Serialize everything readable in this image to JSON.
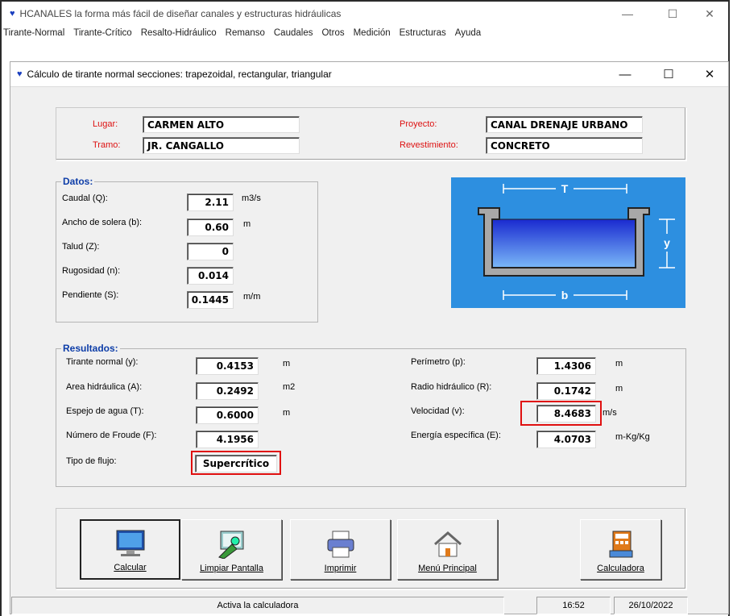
{
  "main_window": {
    "title": "HCANALES la forma más fácil de diseñar canales y estructuras hidráulicas",
    "controls": [
      "—",
      "☐",
      "✕"
    ]
  },
  "menu": [
    "Tirante-Normal",
    "Tirante-Crítico",
    "Resalto-Hidráulico",
    "Remanso",
    "Caudales",
    "Otros",
    "Medición",
    "Estructuras",
    "Ayuda"
  ],
  "child_window": {
    "title": "Cálculo de tirante normal secciones: trapezoidal, rectangular, triangular",
    "controls": [
      "—",
      "☐",
      "✕"
    ]
  },
  "header": {
    "lugar_label": "Lugar:",
    "lugar_value": "CARMEN ALTO",
    "tramo_label": "Tramo:",
    "tramo_value": "JR. CANGALLO",
    "proyecto_label": "Proyecto:",
    "proyecto_value": "CANAL DRENAJE URBANO",
    "revestimiento_label": "Revestimiento:",
    "revestimiento_value": "CONCRETO"
  },
  "datos": {
    "title": "Datos:",
    "rows": [
      {
        "label": "Caudal (Q):",
        "value": "2.11",
        "unit": "m3/s"
      },
      {
        "label": "Ancho de solera (b):",
        "value": "0.60",
        "unit": "m"
      },
      {
        "label": "Talud (Z):",
        "value": "0",
        "unit": ""
      },
      {
        "label": "Rugosidad (n):",
        "value": "0.014",
        "unit": ""
      },
      {
        "label": "Pendiente (S):",
        "value": "0.1445",
        "unit": "m/m"
      }
    ]
  },
  "diagram": {
    "top_label": "T",
    "right_label": "y",
    "bottom_label": "b"
  },
  "resultados": {
    "title": "Resultados:",
    "left": [
      {
        "label": "Tirante normal (y):",
        "value": "0.4153",
        "unit": "m"
      },
      {
        "label": "Area hidráulica (A):",
        "value": "0.2492",
        "unit": "m2"
      },
      {
        "label": "Espejo de agua (T):",
        "value": "0.6000",
        "unit": "m"
      },
      {
        "label": "Número de Froude (F):",
        "value": "4.1956",
        "unit": ""
      }
    ],
    "tipo_label": "Tipo de flujo:",
    "tipo_value": "Supercrítico",
    "right": [
      {
        "label": "Perímetro (p):",
        "value": "1.4306",
        "unit": "m"
      },
      {
        "label": "Radio hidráulico (R):",
        "value": "0.1742",
        "unit": "m"
      },
      {
        "label": "Velocidad (v):",
        "value": "8.4683",
        "unit": "m/s"
      },
      {
        "label": "Energía específica (E):",
        "value": "4.0703",
        "unit": "m-Kg/Kg"
      }
    ]
  },
  "buttons": {
    "calcular": "Calcular",
    "limpiar": "Limpiar Pantalla",
    "imprimir": "Imprimir",
    "menu": "Menú Principal",
    "calculadora": "Calculadora"
  },
  "status": {
    "message": "Activa la calculadora",
    "time": "16:52",
    "date": "26/10/2022"
  },
  "colors": {
    "accent_blue": "#0d3da8",
    "label_red": "#d11111",
    "highlight_red": "#e01010",
    "diagram_bg": "#2d8fe0"
  }
}
